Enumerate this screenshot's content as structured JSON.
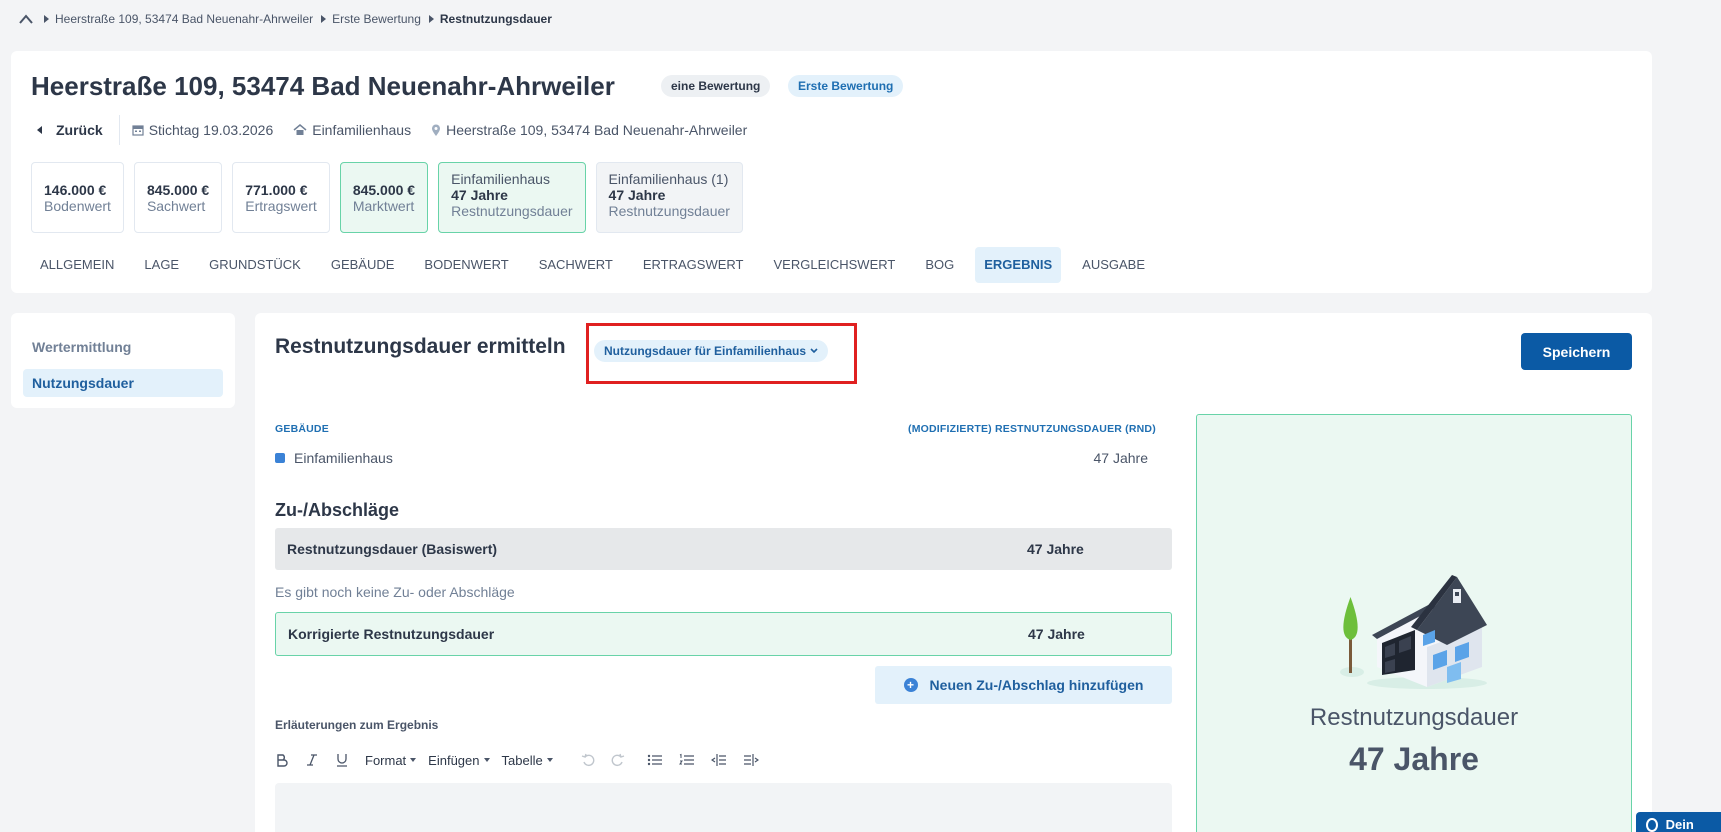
{
  "breadcrumb": {
    "items": [
      "Heerstraße 109, 53474 Bad Neuenahr-Ahrweiler",
      "Erste Bewertung",
      "Restnutzungsdauer"
    ]
  },
  "header": {
    "title": "Heerstraße 109, 53474 Bad Neuenahr-Ahrweiler",
    "badge_count": "eine Bewertung",
    "badge_name": "Erste Bewertung",
    "back_label": "Zurück",
    "stichtag": "Stichtag 19.03.2026",
    "property_type": "Einfamilienhaus",
    "address": "Heerstraße 109, 53474 Bad Neuenahr-Ahrweiler"
  },
  "values": [
    {
      "amount": "146.000 €",
      "label": "Bodenwert"
    },
    {
      "amount": "845.000 €",
      "label": "Sachwert"
    },
    {
      "amount": "771.000 €",
      "label": "Ertragswert"
    },
    {
      "amount": "845.000 €",
      "label": "Marktwert"
    }
  ],
  "rnd_cards": [
    {
      "title": "Einfamilienhaus",
      "value": "47 Jahre",
      "label": "Restnutzungsdauer"
    },
    {
      "title": "Einfamilienhaus (1)",
      "value": "47 Jahre",
      "label": "Restnutzungsdauer"
    }
  ],
  "tabs": [
    "ALLGEMEIN",
    "LAGE",
    "GRUNDSTÜCK",
    "GEBÄUDE",
    "BODENWERT",
    "SACHWERT",
    "ERTRAGSWERT",
    "VERGLEICHSWERT",
    "BOG",
    "ERGEBNIS",
    "AUSGABE"
  ],
  "active_tab": "ERGEBNIS",
  "sidebar": {
    "items": [
      "Wertermittlung",
      "Nutzungsdauer"
    ]
  },
  "main": {
    "title": "Restnutzungsdauer ermitteln",
    "dropdown_label": "Nutzungsdauer für Einfamilienhaus",
    "save_label": "Speichern",
    "col_building": "GEBÄUDE",
    "col_rnd": "(MODIFIZIERTE) RESTNUTZUNGSDAUER (RND)",
    "building_name": "Einfamilienhaus",
    "building_rnd": "47 Jahre",
    "adjust_title": "Zu-/Abschläge",
    "base_label": "Restnutzungsdauer (Basiswert)",
    "base_value": "47 Jahre",
    "empty_msg": "Es gibt noch keine Zu- oder Abschläge",
    "corr_label": "Korrigierte Restnutzungsdauer",
    "corr_value": "47 Jahre",
    "add_label": "Neuen Zu-/Abschlag hinzufügen",
    "notes_label": "Erläuterungen zum Ergebnis",
    "toolbar": {
      "format": "Format",
      "insert": "Einfügen",
      "table": "Tabelle"
    }
  },
  "result": {
    "label": "Restnutzungsdauer",
    "value": "47 Jahre"
  },
  "feedback_label": "Dein Feedback",
  "colors": {
    "primary": "#0b5aa5",
    "accent_green": "#68d3a8",
    "highlight": "#e02020"
  }
}
